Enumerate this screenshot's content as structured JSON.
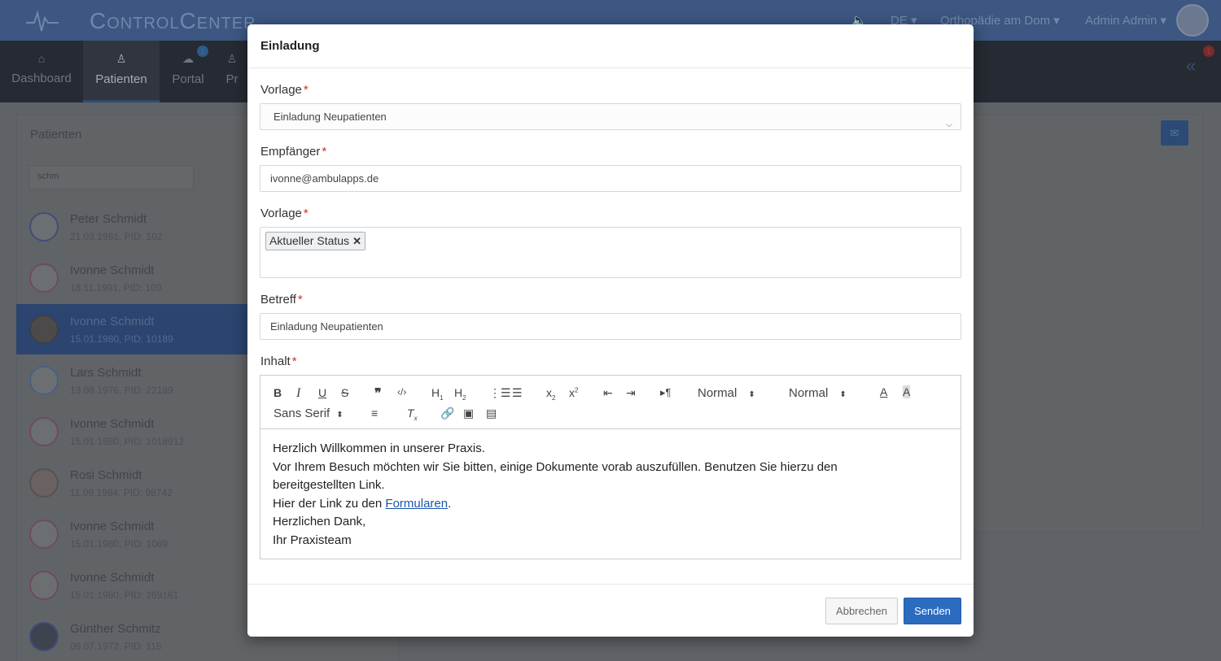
{
  "app": {
    "brand": "ControlCenter",
    "language": "DE",
    "practice": "Orthopädie am Dom",
    "user": "Admin Admin",
    "notif_count": "1"
  },
  "nav": {
    "tabs": [
      {
        "label": "Dashboard",
        "icon": "home-icon"
      },
      {
        "label": "Patienten",
        "icon": "user-icon"
      },
      {
        "label": "Portal",
        "icon": "cloud-icon",
        "badge": "1"
      },
      {
        "label": "Pr",
        "icon": "user-icon"
      }
    ]
  },
  "patients_panel": {
    "title": "Patienten",
    "search_value": "schm",
    "items": [
      {
        "name": "Peter Schmidt",
        "sub": "21.03.1981, PID: 102"
      },
      {
        "name": "Ivonne Schmidt",
        "sub": "18.11.1991, PID: 109"
      },
      {
        "name": "Ivonne Schmidt",
        "sub": "15.01.1980, PID: 10189"
      },
      {
        "name": "Lars Schmidt",
        "sub": "13.08.1976, PID: 22189"
      },
      {
        "name": "Ivonne Schmidt",
        "sub": "15.01.1980, PID: 1018912"
      },
      {
        "name": "Rosi Schmidt",
        "sub": "11.09.1964, PID: 98742"
      },
      {
        "name": "Ivonne Schmidt",
        "sub": "15.01.1980, PID: 1089"
      },
      {
        "name": "Ivonne Schmidt",
        "sub": "15.01.1980, PID: 269161"
      },
      {
        "name": "Günther Schmitz",
        "sub": "06.07.1972, PID: 115"
      }
    ]
  },
  "modal": {
    "title": "Einladung",
    "template_label": "Vorlage",
    "template_value": "Einladung Neupatienten",
    "recipient_label": "Empfänger",
    "recipient_value": "ivonne@ambulapps.de",
    "template2_label": "Vorlage",
    "template2_tag": "Aktueller Status",
    "subject_label": "Betreff",
    "subject_value": "Einladung Neupatienten",
    "content_label": "Inhalt",
    "toolbar": {
      "size1": "Normal",
      "size2": "Normal",
      "font": "Sans Serif"
    },
    "content": {
      "line1": "Herzlich Willkommen in unserer Praxis.",
      "line2": "Vor Ihrem Besuch möchten wir Sie bitten, einige Dokumente vorab auszufüllen. Benutzen Sie hierzu den bereitgestellten Link.",
      "line3_prefix": "Hier der Link zu den ",
      "line3_link": "Formularen",
      "line3_suffix": ".",
      "line4": "Herzlichen Dank,",
      "line5": "Ihr Praxisteam"
    },
    "cancel_label": "Abbrechen",
    "send_label": "Senden"
  }
}
